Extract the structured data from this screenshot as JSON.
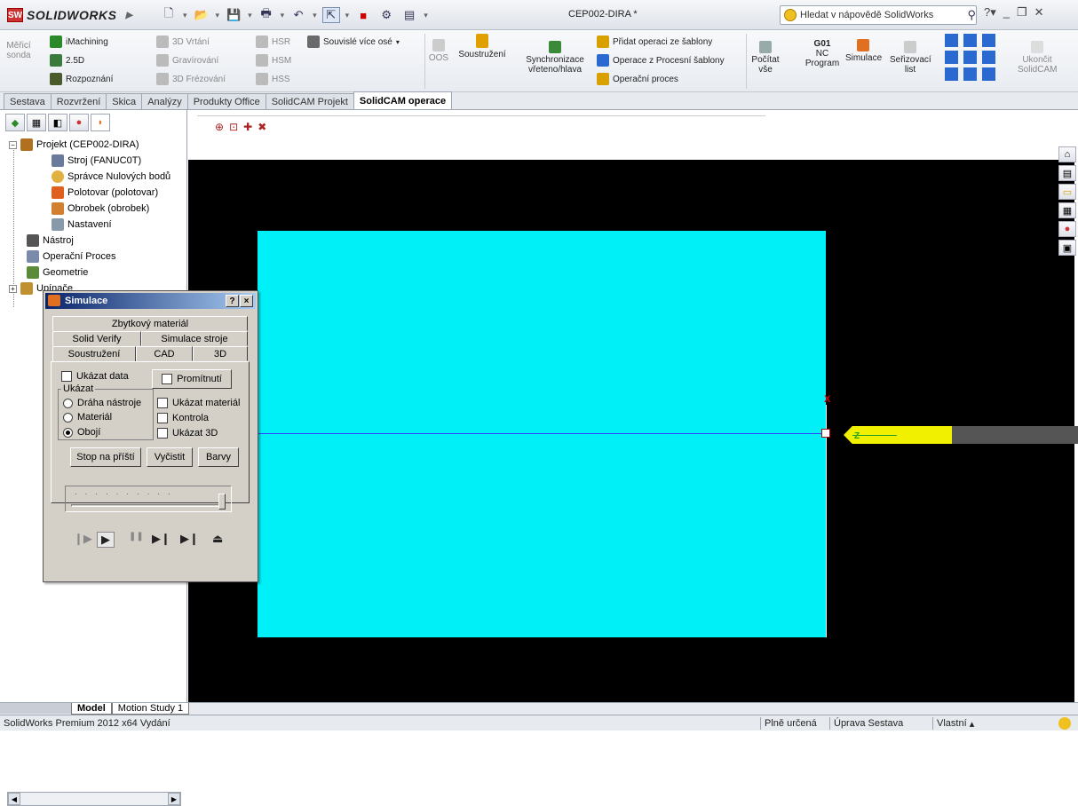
{
  "app": {
    "brand": "SOLIDWORKS",
    "document_title": "CEP002-DIRA *"
  },
  "help_search": {
    "placeholder": "Hledat v nápovědě SolidWorks"
  },
  "ribbon": {
    "meric_sonda": "Měřicí sonda",
    "imachining": "iMachining",
    "l2_5d": "2.5D",
    "rozpoznani": "Rozpoznání",
    "vrtani3d": "3D Vrtání",
    "gravirovani": "Gravírování",
    "frezovani3d": "3D Frézování",
    "hsr": "HSR",
    "hsm": "HSM",
    "hss": "HSS",
    "souvisle": "Souvislé více osé",
    "oos": "OOS",
    "soustruzeni": "Soustružení",
    "synchronizace": "Synchronizace vřeteno/hlava",
    "pridat_operaci": "Přidat operaci ze šablony",
    "operace_sablony": "Operace z Procesní šablony",
    "operacni_proces": "Operační proces",
    "pocitat_vse": "Počítat vše",
    "g01": "G01",
    "nc_program": "NC Program",
    "simulace": "Simulace",
    "serizovaci_list": "Seřizovací list",
    "ukoncit": "Ukončit SolidCAM"
  },
  "tabs": [
    "Sestava",
    "Rozvržení",
    "Skica",
    "Analýzy",
    "Produkty Office",
    "SolidCAM Projekt",
    "SolidCAM operace"
  ],
  "tree": {
    "projekt": "Projekt (CEP002-DIRA)",
    "stroj": "Stroj (FANUC0T)",
    "spravce": "Správce Nulových bodů",
    "polotovar": "Polotovar (polotovar)",
    "obrobek": "Obrobek (obrobek)",
    "nastaveni": "Nastavení",
    "nastroj": "Nástroj",
    "operacni_proces": "Operační Proces",
    "geometrie": "Geometrie",
    "upinace": "Upínače"
  },
  "bottom_tabs": [
    "Model",
    "Motion Study 1"
  ],
  "viewport": {
    "x_label": "X",
    "z_label": "Z"
  },
  "dialog": {
    "title": "Simulace",
    "help_btn": "?",
    "close_btn": "×",
    "tabs_row1": [
      "Zbytkový materiál"
    ],
    "tabs_row2": [
      "Solid Verify",
      "Simulace stroje"
    ],
    "tabs_row3": [
      "Soustružení",
      "CAD",
      "3D"
    ],
    "ukazat_data": "Ukázat data",
    "promitnuti": "Promítnutí",
    "ukazat_group": "Ukázat",
    "draha_nastroje": "Dráha nástroje",
    "material": "Materiál",
    "oboji": "Obojí",
    "ukazat_material": "Ukázat materiál",
    "kontrola": "Kontrola",
    "ukazat_3d": "Ukázat 3D",
    "stop": "Stop na příští",
    "vycistit": "Vyčistit",
    "barvy": "Barvy",
    "slider_value": 1.0
  },
  "status": {
    "left": "SolidWorks Premium 2012 x64 Vydání",
    "plne_urcena": "Plně určená",
    "uprava": "Úprava Sestava",
    "vlastni": "Vlastní"
  },
  "colors": {
    "stock": "#00f0f8",
    "tool": "#f0f000",
    "viewport_bg": "#000000"
  }
}
